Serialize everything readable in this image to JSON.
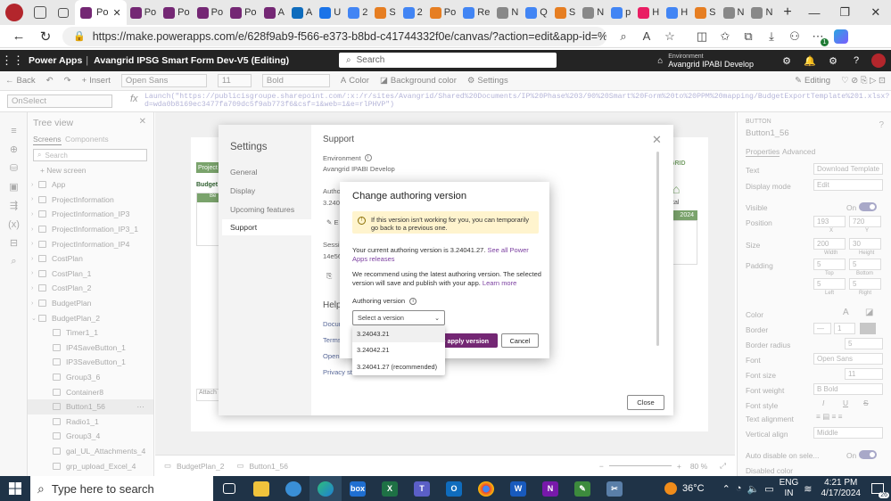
{
  "browser": {
    "tabs": [
      {
        "label": "Po",
        "color": "#742774"
      },
      {
        "label": "Po",
        "color": "#742774"
      },
      {
        "label": "Po",
        "color": "#742774"
      },
      {
        "label": "Po",
        "color": "#742774"
      },
      {
        "label": "A",
        "color": "#742774"
      },
      {
        "label": "A",
        "color": "#0f6cbd"
      },
      {
        "label": "U",
        "color": "#1a73e8"
      },
      {
        "label": "2",
        "color": "#4285f4"
      },
      {
        "label": "S",
        "color": "#e67e22"
      },
      {
        "label": "2",
        "color": "#4285f4"
      },
      {
        "label": "Po",
        "color": "#e67e22"
      },
      {
        "label": "Re",
        "color": "#4285f4"
      },
      {
        "label": "N",
        "color": "#888888"
      },
      {
        "label": "Q",
        "color": "#4285f4"
      },
      {
        "label": "S",
        "color": "#e67e22"
      },
      {
        "label": "N",
        "color": "#888888"
      },
      {
        "label": "p",
        "color": "#4285f4"
      },
      {
        "label": "H",
        "color": "#e91e63"
      },
      {
        "label": "H",
        "color": "#4285f4"
      },
      {
        "label": "S",
        "color": "#e67e22"
      },
      {
        "label": "N",
        "color": "#888888"
      },
      {
        "label": "N",
        "color": "#888888"
      }
    ],
    "active_tab_label": "Po",
    "url": "https://make.powerapps.com/e/628f9ab9-f566-e373-b8bd-c41744332f0e/canvas/?action=edit&app-id=%2Fpr...",
    "ext_badge": "1"
  },
  "powerapps": {
    "brand": "Power Apps",
    "separator": "|",
    "app_title": "Avangrid IPSG Smart Form Dev-V5 (Editing)",
    "search_placeholder": "Search",
    "env_label": "Environment",
    "env_name": "Avangrid IPABI Develop"
  },
  "commandbar": {
    "back": "Back",
    "insert": "Insert",
    "font": "Open Sans",
    "size": "11",
    "weight": "Bold",
    "color": "Color",
    "bg_color": "Background color",
    "settings": "Settings",
    "editing": "Editing"
  },
  "formula": {
    "property": "OnSelect",
    "fx": "fx",
    "line1": "Launch(\"https://publicisgroupe.sharepoint.com/:x:/r/sites/Avangrid/Shared%20Documents/IP%20Phase%203/90%20Smart%20Form%20to%20PPM%20mapping/BudgetExportTemplate%201.xlsx?",
    "line2": "d=wda0b8169ec3477fa709dc5f9ab773f6&csf=1&web=1&e=rlPHVP\")"
  },
  "tree": {
    "title": "Tree view",
    "tab_screens": "Screens",
    "tab_components": "Components",
    "search_placeholder": "Search",
    "new_screen": "+ New screen",
    "items": [
      {
        "label": "App"
      },
      {
        "label": "ProjectInformation"
      },
      {
        "label": "ProjectInformation_IP3"
      },
      {
        "label": "ProjectInformation_IP3_1"
      },
      {
        "label": "ProjectInformation_IP4"
      },
      {
        "label": "CostPlan"
      },
      {
        "label": "CostPlan_1"
      },
      {
        "label": "CostPlan_2"
      },
      {
        "label": "BudgetPlan"
      },
      {
        "label": "BudgetPlan_2"
      },
      {
        "label": "Timer1_1"
      },
      {
        "label": "IP4SaveButton_1"
      },
      {
        "label": "IP3SaveButton_1"
      },
      {
        "label": "Group3_6"
      },
      {
        "label": "Container8"
      },
      {
        "label": "Button1_56"
      },
      {
        "label": "Radio1_1"
      },
      {
        "label": "Group3_4"
      },
      {
        "label": "gal_UL_Attachments_4"
      },
      {
        "label": "grp_upload_Excel_4"
      }
    ],
    "selected": "Button1_56"
  },
  "status": {
    "screen": "BudgetPlan_2",
    "control": "Button1_56",
    "zoom": "80 %"
  },
  "props": {
    "type": "BUTTON",
    "name": "Button1_56",
    "tab_properties": "Properties",
    "tab_advanced": "Advanced",
    "text_label": "Text",
    "text_value": "Download Template",
    "display_label": "Display mode",
    "display_value": "Edit",
    "visible_label": "Visible",
    "visible_value": "On",
    "position_label": "Position",
    "pos_x": "193",
    "pos_y": "720",
    "x": "X",
    "y": "Y",
    "size_label": "Size",
    "width": "200",
    "height": "30",
    "w": "Width",
    "h": "Height",
    "padding_label": "Padding",
    "pad_top": "5",
    "pad_bottom": "5",
    "pad_left": "5",
    "pad_right": "5",
    "top": "Top",
    "bottom": "Bottom",
    "left": "Left",
    "right": "Right",
    "color_label": "Color",
    "border_label": "Border",
    "border_w": "1",
    "radius_label": "Border radius",
    "radius_value": "5",
    "font_label": "Font",
    "font_value": "Open Sans",
    "fontsize_label": "Font size",
    "fontsize_value": "11",
    "fontweight_label": "Font weight",
    "fontweight_value": "B  Bold",
    "fontstyle_label": "Font style",
    "textalign_label": "Text alignment",
    "valign_label": "Vertical align",
    "valign_value": "Middle",
    "autodisable_label": "Auto disable on sele...",
    "autodisable_value": "On",
    "disabledcolor_label": "Disabled color"
  },
  "canvas_app": {
    "project_btn": "Project",
    "budget_head": "Budget",
    "year": "2024",
    "attach": "Attach",
    "ngrid": "NGRID",
    "tal": "tal",
    "col_be": "Be"
  },
  "settings": {
    "title": "Settings",
    "nav": [
      "General",
      "Display",
      "Upcoming features",
      "Support"
    ],
    "active": "Support",
    "support_title": "Support",
    "env_label": "Environment",
    "env_value": "Avangrid IPABI Develop",
    "authoring_label": "Authoring",
    "authoring_value": "3.2404",
    "edit_label": "E",
    "session_label": "Sessio",
    "session_value": "14e56",
    "help_label": "Help",
    "help_links": [
      "Docum",
      "Terms",
      "Open",
      "Privacy sta"
    ],
    "close": "Close"
  },
  "dialog": {
    "title": "Change authoring version",
    "warning": "If this version isn't working for you, you can temporarily go back to a previous one.",
    "current_text": "Your current authoring version is 3.24041.27.",
    "current_link": "See all Power Apps releases",
    "recommend_text": "We recommend using the latest authoring version. The selected version will save and publish with your app.",
    "learn_more": "Learn more",
    "field_label": "Authoring version",
    "select_placeholder": "Select a version",
    "options": [
      "3.24043.21",
      "3.24042.21",
      "3.24041.27 (recommended)"
    ],
    "apply": "d + apply version",
    "cancel": "Cancel"
  },
  "taskbar": {
    "search_placeholder": "Type here to search",
    "weather": "36°C",
    "lang1": "ENG",
    "lang2": "IN",
    "time": "4:21 PM",
    "date": "4/17/2024",
    "notif": "26"
  }
}
